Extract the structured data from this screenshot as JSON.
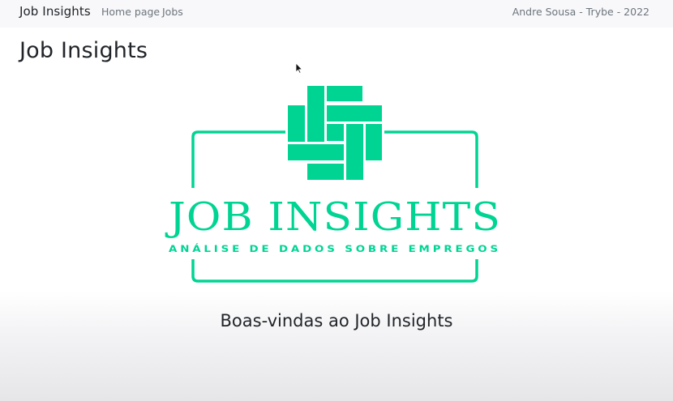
{
  "navbar": {
    "brand": "Job Insights",
    "links": [
      {
        "label": "Home page"
      },
      {
        "label": "Jobs"
      }
    ],
    "credit": "Andre Sousa - Trybe - 2022"
  },
  "page": {
    "title": "Job Insights",
    "welcome": "Boas-vindas ao Job Insights"
  },
  "logo": {
    "title": "JOB INSIGHTS",
    "subtitle": "ANÁLISE DE DADOS SOBRE EMPREGOS",
    "color": "#00d493"
  },
  "icons": {
    "cursor": "mouse-pointer-icon"
  }
}
